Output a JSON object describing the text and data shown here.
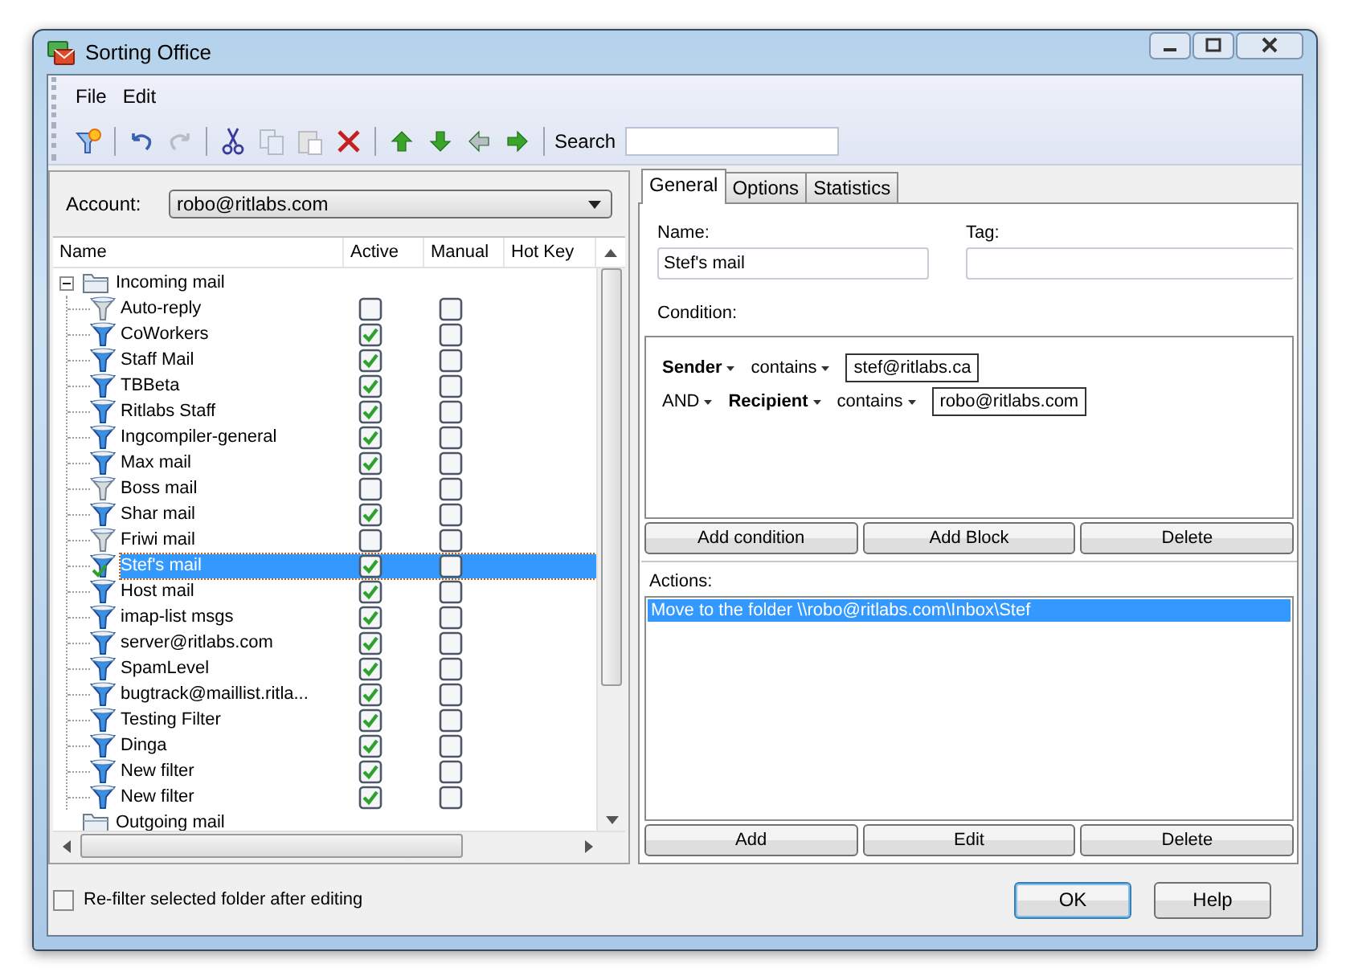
{
  "window": {
    "title": "Sorting Office"
  },
  "menu": [
    "File",
    "Edit"
  ],
  "toolbar": {
    "groups": [
      [
        {
          "kind": "wizard",
          "disabled": false
        }
      ],
      [
        {
          "kind": "undo",
          "disabled": false
        },
        {
          "kind": "redo",
          "disabled": true
        }
      ],
      [
        {
          "kind": "cut",
          "disabled": false
        },
        {
          "kind": "copy",
          "disabled": true
        },
        {
          "kind": "paste",
          "disabled": true
        },
        {
          "kind": "delete",
          "disabled": false
        }
      ],
      [
        {
          "kind": "up",
          "disabled": false
        },
        {
          "kind": "down",
          "disabled": false
        },
        {
          "kind": "left",
          "disabled": true
        },
        {
          "kind": "right",
          "disabled": false
        }
      ]
    ],
    "search_label": "Search"
  },
  "account": {
    "label": "Account:",
    "value": "robo@ritlabs.com"
  },
  "tree": {
    "columns": [
      "Name",
      "Active",
      "Manual",
      "Hot Key"
    ],
    "folders": [
      {
        "name": "Incoming mail",
        "expanded": true,
        "children": [
          {
            "name": "Auto-reply",
            "active": false,
            "manual": false,
            "selected": false
          },
          {
            "name": "CoWorkers",
            "active": true,
            "manual": false,
            "selected": false
          },
          {
            "name": "Staff Mail",
            "active": true,
            "manual": false,
            "selected": false
          },
          {
            "name": "TBBeta",
            "active": true,
            "manual": false,
            "selected": false
          },
          {
            "name": "Ritlabs Staff",
            "active": true,
            "manual": false,
            "selected": false
          },
          {
            "name": "Ingcompiler-general",
            "active": true,
            "manual": false,
            "selected": false
          },
          {
            "name": "Max mail",
            "active": true,
            "manual": false,
            "selected": false
          },
          {
            "name": "Boss mail",
            "active": false,
            "manual": false,
            "selected": false
          },
          {
            "name": "Shar mail",
            "active": true,
            "manual": false,
            "selected": false
          },
          {
            "name": "Friwi mail",
            "active": false,
            "manual": false,
            "selected": false
          },
          {
            "name": "Stef's mail",
            "active": true,
            "manual": false,
            "selected": true
          },
          {
            "name": "Host mail",
            "active": true,
            "manual": false,
            "selected": false
          },
          {
            "name": "imap-list msgs",
            "active": true,
            "manual": false,
            "selected": false
          },
          {
            "name": "server@ritlabs.com",
            "active": true,
            "manual": false,
            "selected": false
          },
          {
            "name": "SpamLevel",
            "active": true,
            "manual": false,
            "selected": false
          },
          {
            "name": "bugtrack@maillist.ritla...",
            "active": true,
            "manual": false,
            "selected": false
          },
          {
            "name": "Testing Filter",
            "active": true,
            "manual": false,
            "selected": false
          },
          {
            "name": "Dinga",
            "active": true,
            "manual": false,
            "selected": false
          },
          {
            "name": "New filter",
            "active": true,
            "manual": false,
            "selected": false
          },
          {
            "name": "New filter",
            "active": true,
            "manual": false,
            "selected": false
          }
        ]
      },
      {
        "name": "Outgoing mail"
      }
    ]
  },
  "refilter": {
    "label": "Re-filter selected folder after editing",
    "checked": false
  },
  "tabs": [
    {
      "label": "General",
      "selected": true
    },
    {
      "label": "Options",
      "selected": false
    },
    {
      "label": "Statistics",
      "selected": false
    }
  ],
  "name_field": {
    "label": "Name:",
    "value": "Stef's mail"
  },
  "tag_field": {
    "label": "Tag:"
  },
  "condition_label": "Condition:",
  "conditions": [
    {
      "field": "Sender",
      "operator": "contains",
      "value": "stef@ritlabs.ca"
    },
    {
      "connector": "AND",
      "field": "Recipient",
      "operator": "contains",
      "value": "robo@ritlabs.com"
    }
  ],
  "condition_buttons": [
    "Add condition",
    "Add Block",
    "Delete"
  ],
  "actions_label": "Actions:",
  "actions": [
    {
      "text": "Move to the folder \\\\robo@ritlabs.com\\Inbox\\Stef",
      "selected": true
    }
  ],
  "action_buttons": [
    "Add",
    "Edit",
    "Delete"
  ],
  "dialog_buttons": [
    {
      "label": "OK",
      "default": true
    },
    {
      "label": "Help",
      "default": false
    }
  ]
}
